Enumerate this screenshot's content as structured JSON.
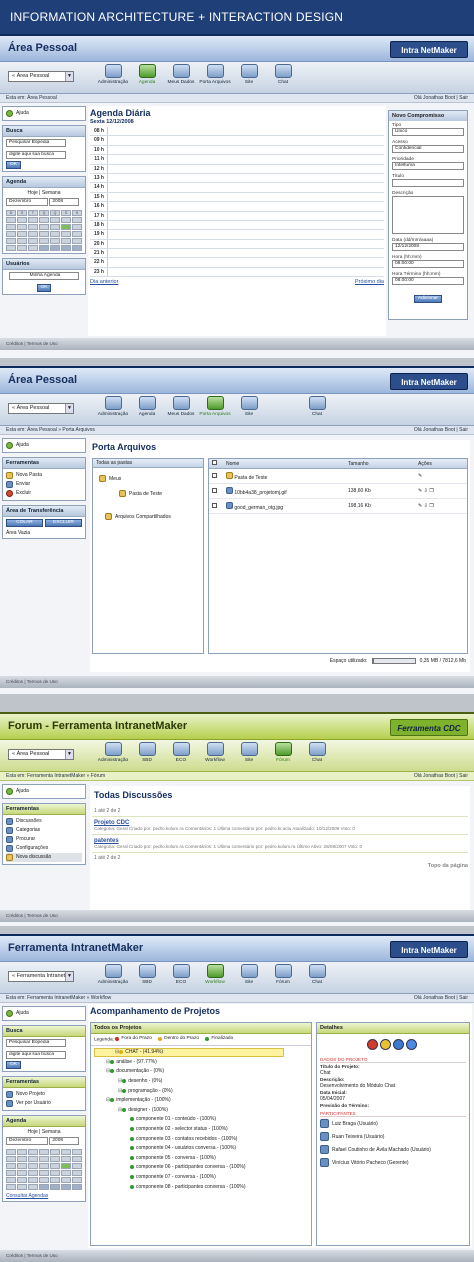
{
  "banner": "INFORMATION ARCHITECTURE + INTERACTION DESIGN",
  "logo_text": "Intra NetMaker",
  "user_greeting": "Olá Jonathas Boot | Sair",
  "footer": "Créditos | Termos de Uso",
  "panels": {
    "p1": {
      "title": "Área Pessoal",
      "select": "« Área Pessoal",
      "toolbar": [
        "Administração",
        "Agenda",
        "Meus Dados",
        "Porta Arquivos",
        "Site",
        "Chat"
      ],
      "crumb": "Esta em: Área Pessoal",
      "help": "Ajuda",
      "search": {
        "title": "Busca",
        "scope": "Pesquisar Bópedia",
        "query": "digite aqui sua busca",
        "ok": "OK"
      },
      "agenda": {
        "title": "Agenda",
        "tabs": "Hoje | Semana",
        "month": "Dezembro",
        "year": "2008",
        "days": [
          "D",
          "S",
          "T",
          "Q",
          "Q",
          "S",
          "S"
        ]
      },
      "users": {
        "title": "Usuários",
        "value": "Minha Agenda",
        "ok": "OK"
      },
      "main": {
        "heading": "Agenda Diária",
        "date": "Sexta 12/12/2008",
        "hours": [
          "08 h",
          "09 h",
          "10 h",
          "11 h",
          "12 h",
          "13 h",
          "14 h",
          "15 h",
          "16 h",
          "17 h",
          "18 h",
          "19 h",
          "20 h",
          "21 h",
          "22 h",
          "23 h"
        ],
        "prev": "Dia anterior",
        "next": "Próximo dia"
      },
      "form": {
        "title": "Novo Compromisso",
        "tipo_label": "Tipo",
        "tipo": "Único",
        "acesso_label": "Acesso",
        "acesso": "Confidencial",
        "prioridade_label": "Prioridade",
        "prioridade": "Intelfuma",
        "titulo_label": "Título",
        "desc_label": "Descrição",
        "data_label": "Data (dd/mm/aaaa)",
        "data": "12/12/2008",
        "hinicio_label": "Hora (hh:mm)",
        "hinicio": "08:00:00",
        "hfim_label": "Hora Término (hh:mm)",
        "hfim": "08:00:00",
        "add": "Adicionar"
      }
    },
    "p2": {
      "title": "Área Pessoal",
      "select": "« Área Pessoal",
      "toolbar": [
        "Administração",
        "Agenda",
        "Meus Dados",
        "Porta Arquivos",
        "Site",
        "Chat"
      ],
      "crumb": "Esta em: Área Pessoal » Porta Arquivos",
      "help": "Ajuda",
      "tools": {
        "title": "Ferramentas",
        "items": [
          "Nova Pasta",
          "Enviar",
          "Excluir"
        ]
      },
      "transfer": {
        "title": "Área de Transferência",
        "copy": "COLAR",
        "clear": "EXCLUIR",
        "empty": "Área Vazia"
      },
      "main": {
        "heading": "Porta Arquivos",
        "tree_header": "Todas as pastas",
        "tree": [
          "Meus",
          "Pasta de Teste",
          "Arquivos Compartilhados"
        ],
        "cols": [
          "Nome",
          "Tamanho",
          "Ações"
        ],
        "files": [
          {
            "name": "Pasta de Teste",
            "size": ""
          },
          {
            "name": "10bb4a38_projetomj.gif",
            "size": "138,60 Kb"
          },
          {
            "name": "good_german_otg.jpg",
            "size": "198,16 Kb"
          }
        ],
        "space_label": "Espaço utilizado:",
        "space_value": "0,35 MB / 7812,6 Mb",
        "space_pct": 0.04
      }
    },
    "p3": {
      "title": "Forum - Ferramenta IntranetMaker",
      "logo": "Ferramenta CDC",
      "select": "« Área Pessoal",
      "toolbar": [
        "Administração",
        "SBD",
        "ECO",
        "Workflow",
        "Site",
        "Fórum",
        "Chat"
      ],
      "crumb": "Esta em: Ferramenta IntranetMaker » Fórum",
      "help": "Ajuda",
      "tools": {
        "title": "Ferramentas",
        "items": [
          "Discussões",
          "Categorias",
          "Procurar",
          "Configurações",
          "Nova discussão"
        ]
      },
      "main": {
        "heading": "Todas Discussões",
        "pager": "1 até 2 de 2",
        "pager2": "1 até 2 de 2",
        "top": "Topo da página",
        "posts": [
          {
            "title": "Projeto CDC",
            "meta": "Categoria: Geral   Criado por: pedro.kolum.ra   Comentários: 1   Última comentário por: pedro.kr.actu   Atualizado: 10/12/2008   Voto: 0"
          },
          {
            "title": "patentes",
            "meta": "Categoria: Geral   Criado por: pedro.kolum.ra   Comentários: 1   Última comentário por: pedro.kolum.ra   Último Ativo: 28/08/2007   Voto: 0"
          }
        ]
      }
    },
    "p4": {
      "title": "Ferramenta IntranetMaker",
      "select": "« Ferramenta IntranetM",
      "toolbar": [
        "Administração",
        "SBD",
        "ECO",
        "Workflow",
        "Site",
        "Fórum",
        "Chat"
      ],
      "crumb": "Esta em: Ferramenta IntranetMaker » Workflow",
      "help": "Ajuda",
      "search": {
        "title": "Busca",
        "scope": "Pesquisar Bópedia",
        "query": "digite aqui sua busca",
        "ok": "OK"
      },
      "tools": {
        "title": "Ferramentas",
        "items": [
          "Novo Projeto",
          "Ver por Usuário"
        ]
      },
      "agenda": {
        "title": "Agenda",
        "tabs": "Hoje | Semana",
        "month": "Dezembro",
        "year": "2008",
        "link": "Consultar Agendas"
      },
      "main": {
        "heading": "Acompanhamento de Projetos",
        "tree_title": "Todos os Projetos",
        "legend_label": "Legenda:",
        "legend": [
          "Fora do Prazo",
          "Dentro do Prazo",
          "Finalizado"
        ],
        "legend_colors": [
          "#d02a1f",
          "#f0a020",
          "#2e9a2e"
        ],
        "nodes": [
          {
            "text": "CHAT - (41.94%)",
            "depth": 0,
            "dot": "#e1b400"
          },
          {
            "text": "análise - (97.77%)",
            "depth": 1,
            "dot": "#2e9a2e"
          },
          {
            "text": "documentação - (0%)",
            "depth": 1,
            "dot": "#2e9a2e"
          },
          {
            "text": "desenho - (0%)",
            "depth": 2,
            "dot": "#2e9a2e"
          },
          {
            "text": "programação - (0%)",
            "depth": 2,
            "dot": "#2e9a2e"
          },
          {
            "text": "implementação - (100%)",
            "depth": 1,
            "dot": "#2e9a2e"
          },
          {
            "text": "designer - (100%)",
            "depth": 2,
            "dot": "#2e9a2e"
          },
          {
            "text": "componente 01 - conteúdo - (100%)",
            "depth": 3,
            "dot": "#2e9a2e"
          },
          {
            "text": "componente 02 - selector status - (100%)",
            "depth": 3,
            "dot": "#2e9a2e"
          },
          {
            "text": "componente 03 - contatos recebidos - (100%)",
            "depth": 3,
            "dot": "#2e9a2e"
          },
          {
            "text": "componente 04 - usuários conversa - (100%)",
            "depth": 3,
            "dot": "#2e9a2e"
          },
          {
            "text": "componente 05 - conversa - (100%)",
            "depth": 3,
            "dot": "#2e9a2e"
          },
          {
            "text": "componente 06 - participantes conversa - (100%)",
            "depth": 3,
            "dot": "#2e9a2e"
          },
          {
            "text": "componente 07 - conversa - (100%)",
            "depth": 3,
            "dot": "#2e9a2e"
          },
          {
            "text": "componente 08 - participantes conversa - (100%)",
            "depth": 3,
            "dot": "#2e9a2e"
          }
        ],
        "details": {
          "title": "Detalhes",
          "section": "DADOS DO PROJETO",
          "fields": [
            [
              "Título do Projeto:",
              "Chat"
            ],
            [
              "Descrição:",
              "Desenvolvimento do Módulo Chat"
            ],
            [
              "Data Inicial:",
              "05/04/2007"
            ],
            [
              "Previsão do Término:",
              ""
            ]
          ],
          "participants_title": "PARTICIPANTES",
          "participants": [
            "Luiz Braga (Usuário)",
            "Ruan Teixeira (Usuário)",
            "Rafael Coutinho de Ávila Machado (Usuário)",
            "Vinícius Vitório Pacheco (Gerente)"
          ]
        }
      }
    }
  }
}
